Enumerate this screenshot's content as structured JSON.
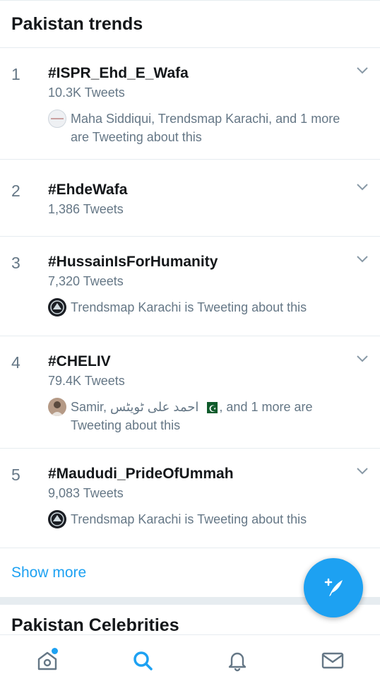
{
  "header": {
    "title": "Pakistan trends"
  },
  "trends": [
    {
      "rank": "1",
      "hashtag": "#ISPR_Ehd_E_Wafa",
      "count": "10.3K Tweets",
      "context": "Maha Siddiqui, Trendsmap Karachi, and 1 more are Tweeting about this",
      "avatar": "maha-avatar"
    },
    {
      "rank": "2",
      "hashtag": "#EhdeWafa",
      "count": "1,386 Tweets"
    },
    {
      "rank": "3",
      "hashtag": "#HussainIsForHumanity",
      "count": "7,320 Tweets",
      "context": "Trendsmap Karachi is Tweeting about this",
      "avatar": "trendsmap-avatar"
    },
    {
      "rank": "4",
      "hashtag": "#CHELIV",
      "count": "79.4K Tweets",
      "context_parts": {
        "before": "Samir, ",
        "urdu_name": "احمد علی ٹویٹس",
        "after": ", and 1 more are Tweeting about this"
      },
      "avatar": "samir-avatar",
      "flag_icon": "pakistan-flag-icon"
    },
    {
      "rank": "5",
      "hashtag": "#Maududi_PrideOfUmmah",
      "count": "9,083 Tweets",
      "context": "Trendsmap Karachi is Tweeting about this",
      "avatar": "trendsmap-avatar"
    }
  ],
  "show_more": "Show more",
  "section2": {
    "title": "Pakistan Celebrities"
  },
  "fab": {
    "icon": "compose-tweet-icon"
  },
  "bottom_nav": {
    "items": [
      {
        "icon": "home-icon",
        "has_notification": true
      },
      {
        "icon": "search-icon",
        "active": true
      },
      {
        "icon": "notifications-bell-icon"
      },
      {
        "icon": "messages-envelope-icon"
      }
    ]
  },
  "colors": {
    "accent": "#1da1f2",
    "text": "#14171a",
    "secondary": "#657786",
    "divider": "#e6ecf0"
  }
}
